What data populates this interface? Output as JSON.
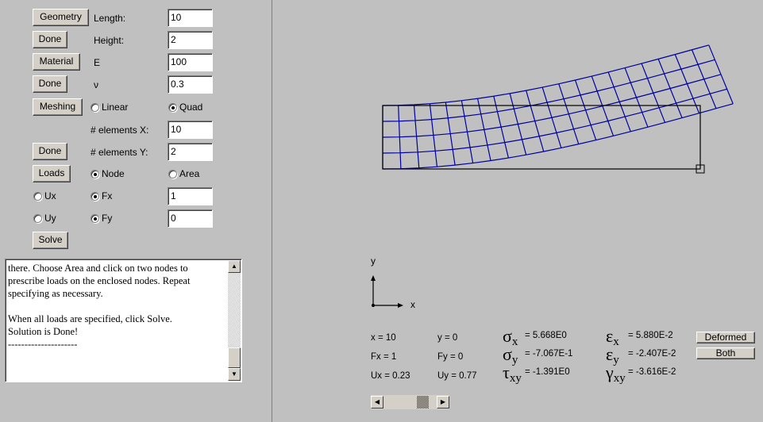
{
  "controls": {
    "geometry_button": "Geometry",
    "length_label": "Length:",
    "length_value": "10",
    "done_geometry_button": "Done",
    "height_label": "Height:",
    "height_value": "2",
    "material_button": "Material",
    "e_label": "E",
    "e_value": "100",
    "done_material_button": "Done",
    "nu_label": "ν",
    "nu_value": "0.3",
    "meshing_button": "Meshing",
    "linear_label": "Linear",
    "linear_selected": false,
    "quad_label": "Quad",
    "quad_selected": true,
    "elements_x_label": "# elements X:",
    "elements_x_value": "10",
    "done_meshing_button": "Done",
    "elements_y_label": "# elements Y:",
    "elements_y_value": "2",
    "loads_button": "Loads",
    "node_label": "Node",
    "node_selected": true,
    "area_label": "Area",
    "area_selected": false,
    "ux_label": "Ux",
    "ux_selected": false,
    "fx_label": "Fx",
    "fx_selected": true,
    "fx_value": "1",
    "uy_label": "Uy",
    "uy_selected": false,
    "fy_label": "Fy",
    "fy_selected": true,
    "fy_value": "0",
    "solve_button": "Solve"
  },
  "log": {
    "text": "there. Choose Area and click on two nodes to\nprescribe loads on the enclosed nodes. Repeat\nspecifying as necessary.\n\nWhen all loads are specified, click Solve.\nSolution is Done!\n---------------------",
    "scroll_position_fraction": 0.9
  },
  "plot": {
    "mesh_color": "#0000a0",
    "outline_color": "#000000",
    "axis_x_label": "x",
    "axis_y_label": "y",
    "mesh_cols": 20,
    "mesh_rows": 4
  },
  "results": {
    "x": "x = 10",
    "y": "y = 0",
    "fx": "Fx = 1",
    "fy": "Fy = 0",
    "ux": "Ux = 0.23",
    "uy": "Uy = 0.77",
    "sigma_x_sym": "σ",
    "sigma_x_sub": "x",
    "sigma_x": "= 5.668E0",
    "sigma_y_sym": "σ",
    "sigma_y_sub": "y",
    "sigma_y": "= -7.067E-1",
    "tau_xy_sym": "τ",
    "tau_xy_sub": "xy",
    "tau_xy": "= -1.391E0",
    "eps_x_sym": "ε",
    "eps_x_sub": "x",
    "eps_x": "= 5.880E-2",
    "eps_y_sym": "ε",
    "eps_y_sub": "y",
    "eps_y": "= -2.407E-2",
    "gamma_xy_sym": "γ",
    "gamma_xy_sub": "xy",
    "gamma_xy": "= -3.616E-2"
  },
  "view_buttons": {
    "deformed": "Deformed",
    "both": "Both"
  },
  "scale_slider": {
    "value_fraction": 0.8
  }
}
